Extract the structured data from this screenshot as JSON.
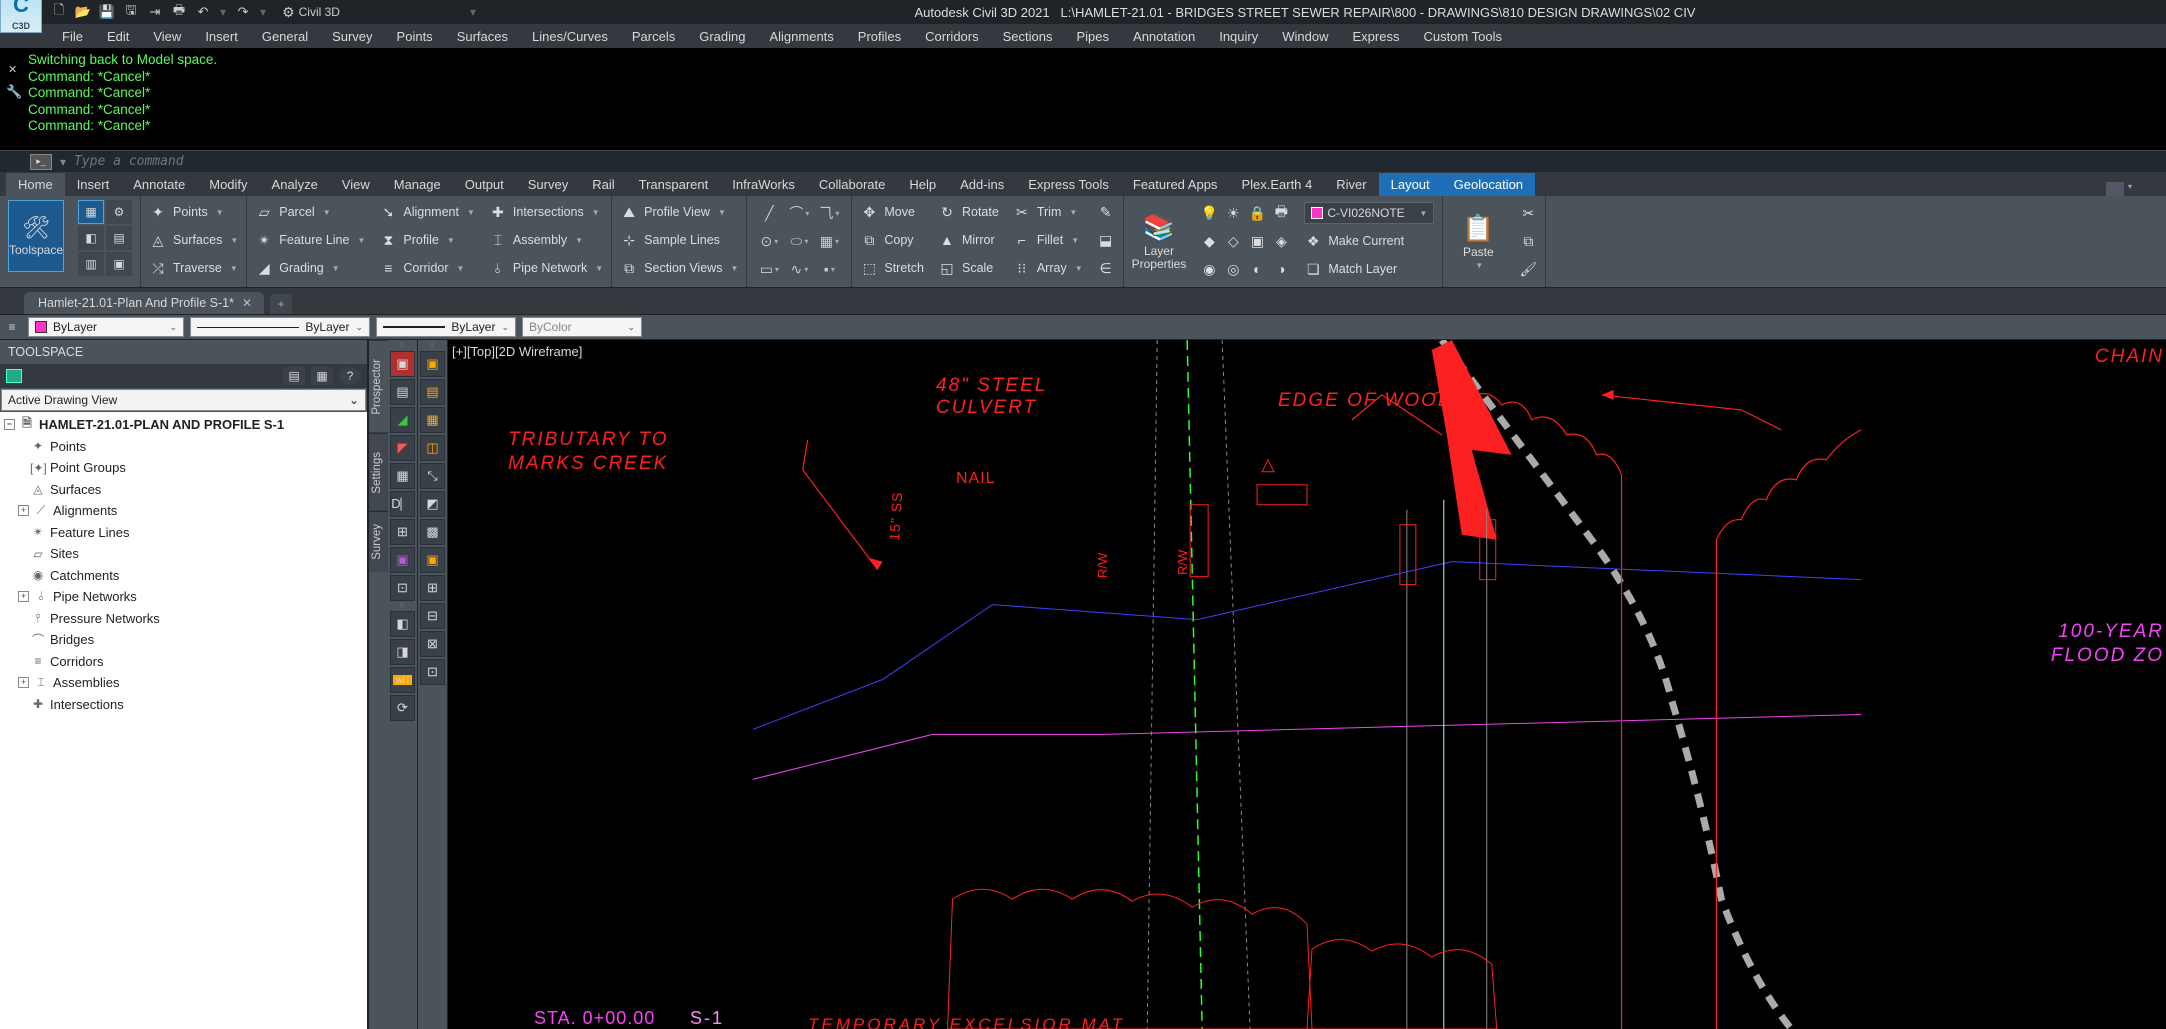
{
  "title": {
    "app": "Autodesk Civil 3D 2021",
    "path": "L:\\HAMLET-21.01 - BRIDGES STREET SEWER REPAIR\\800 - DRAWINGS\\810 DESIGN DRAWINGS\\02 CIV"
  },
  "workspace": "Civil 3D",
  "menus": [
    "File",
    "Edit",
    "View",
    "Insert",
    "General",
    "Survey",
    "Points",
    "Surfaces",
    "Lines/Curves",
    "Parcels",
    "Grading",
    "Alignments",
    "Profiles",
    "Corridors",
    "Sections",
    "Pipes",
    "Annotation",
    "Inquiry",
    "Window",
    "Express",
    "Custom Tools"
  ],
  "cmd": {
    "lines": [
      "Switching back to Model space.",
      "Command: *Cancel*",
      "Command: *Cancel*",
      "Command: *Cancel*",
      "Command: *Cancel*"
    ],
    "placeholder": "Type a command"
  },
  "ribbon_tabs": [
    "Home",
    "Insert",
    "Annotate",
    "Modify",
    "Analyze",
    "View",
    "Manage",
    "Output",
    "Survey",
    "Rail",
    "Transparent",
    "InfraWorks",
    "Collaborate",
    "Help",
    "Add-ins",
    "Express Tools",
    "Featured Apps",
    "Plex.Earth 4",
    "River",
    "Layout",
    "Geolocation"
  ],
  "ribbon": {
    "toolspace": "Toolspace",
    "create_ground": {
      "points": "Points",
      "surfaces": "Surfaces",
      "traverse": "Traverse"
    },
    "create_design": {
      "parcel": "Parcel",
      "feature": "Feature Line",
      "grading": "Grading",
      "alignment": "Alignment",
      "profile": "Profile",
      "corridor": "Corridor",
      "intersections": "Intersections",
      "assembly": "Assembly",
      "pipe": "Pipe Network"
    },
    "profile_views": {
      "pv": "Profile View",
      "sample": "Sample Lines",
      "section": "Section Views"
    },
    "modify": {
      "move": "Move",
      "copy": "Copy",
      "stretch": "Stretch",
      "rotate": "Rotate",
      "mirror": "Mirror",
      "scale": "Scale",
      "trim": "Trim",
      "fillet": "Fillet",
      "array": "Array"
    },
    "layers": {
      "props": "Layer\nProperties",
      "current_layer": "C-VI026NOTE",
      "make_current": "Make Current",
      "match": "Match Layer"
    },
    "clipboard": {
      "paste": "Paste"
    }
  },
  "doc_tab": "Hamlet-21.01-Plan And Profile S-1*",
  "props": {
    "color": "ByLayer",
    "line": "ByLayer",
    "lw": "ByLayer",
    "plot": "ByColor"
  },
  "toolspace": {
    "title": "TOOLSPACE",
    "view": "Active Drawing View",
    "root": "HAMLET-21.01-PLAN AND PROFILE S-1",
    "nodes": [
      "Points",
      "Point Groups",
      "Surfaces",
      "Alignments",
      "Feature Lines",
      "Sites",
      "Catchments",
      "Pipe Networks",
      "Pressure Networks",
      "Bridges",
      "Corridors",
      "Assemblies",
      "Intersections"
    ],
    "vtabs": [
      "Prospector",
      "Settings",
      "Survey"
    ]
  },
  "viewport": {
    "label": "[+][Top][2D Wireframe]",
    "texts": {
      "tributary": "TRIBUTARY TO\nMARKS CREEK",
      "culvert": "48\" STEEL\nCULVERT",
      "nail": "NAIL",
      "edge": "EDGE OF WOODS",
      "chain": "CHAIN",
      "flood": "100-YEAR\nFLOOD ZO",
      "ss": "15\" SS",
      "rw": "R/W",
      "sta": "STA. 0+00.00",
      "s1": "S-1",
      "temp": "TEMPORARY  EXCELSIOR  MAT"
    }
  }
}
